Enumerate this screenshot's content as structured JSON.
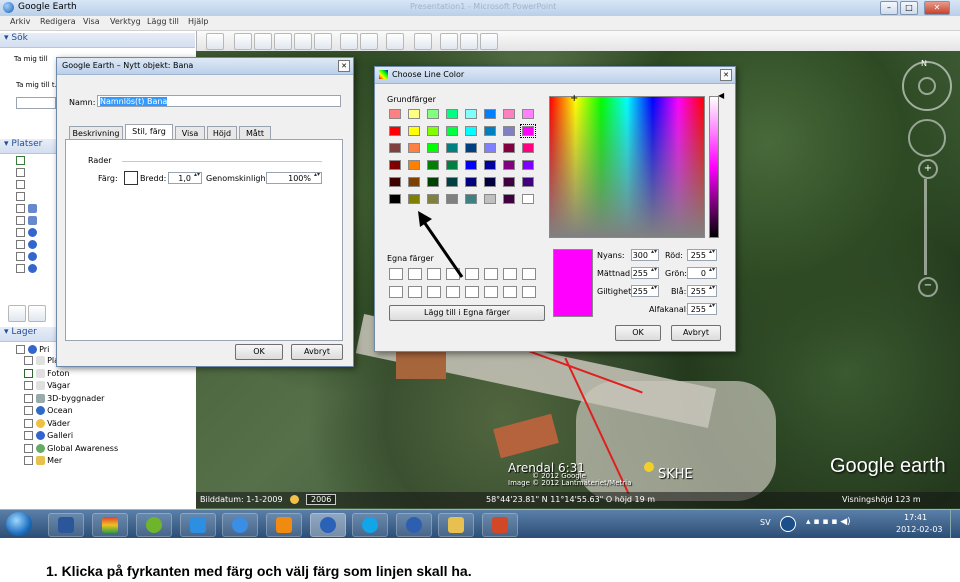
{
  "window": {
    "title": "Google Earth",
    "ghost_title": "Presentation1 - Microsoft PowerPoint",
    "controls": [
      "–",
      "□",
      "✕"
    ]
  },
  "menu": [
    "Arkiv",
    "Redigera",
    "Visa",
    "Verktyg",
    "Lägg till",
    "Hjälp"
  ],
  "sidebar": {
    "search_header": "Sök",
    "search_hint_1": "Ta mig till",
    "search_hint_2": "Ta mig till t.",
    "places_header": "Platser",
    "layers_header": "Lager",
    "layers_root_label": "Pri",
    "layers": [
      "Platser",
      "Foton",
      "Vägar",
      "3D-byggnader",
      "Ocean",
      "Väder",
      "Galleri",
      "Global Awareness",
      "Mer"
    ]
  },
  "new_object_dialog": {
    "title": "Google Earth – Nytt objekt: Bana",
    "name_label": "Namn:",
    "name_value": "Namnlös(t) Bana",
    "tabs": [
      "Beskrivning",
      "Stil, färg",
      "Visa",
      "Höjd",
      "Mått"
    ],
    "active_tab_index": 1,
    "section_title": "Rader",
    "color_label": "Färg:",
    "width_label": "Bredd:",
    "width_value": "1,0",
    "opacity_label": "Genomskinlighet:",
    "opacity_value": "100%",
    "ok_label": "OK",
    "cancel_label": "Avbryt"
  },
  "color_dialog": {
    "title": "Choose Line Color",
    "basic_colors_label": "Grundfärger",
    "custom_colors_label": "Egna färger",
    "add_custom_label": "Lägg till i Egna färger",
    "basic_colors": [
      "#ff8080",
      "#ffff80",
      "#80ff80",
      "#00ff80",
      "#80ffff",
      "#0080ff",
      "#ff80c0",
      "#ff80ff",
      "#ff0000",
      "#ffff00",
      "#80ff00",
      "#00ff40",
      "#00ffff",
      "#0080c0",
      "#8080c0",
      "#ff00ff",
      "#804040",
      "#ff8040",
      "#00ff00",
      "#008080",
      "#004080",
      "#8080ff",
      "#800040",
      "#ff0080",
      "#800000",
      "#ff8000",
      "#008000",
      "#008040",
      "#0000ff",
      "#0000a0",
      "#800080",
      "#8000ff",
      "#400000",
      "#804000",
      "#004000",
      "#004040",
      "#000080",
      "#000040",
      "#400040",
      "#400080",
      "#000000",
      "#808000",
      "#808040",
      "#808080",
      "#408080",
      "#c0c0c0",
      "#400040",
      "#ffffff"
    ],
    "selected_color": "#ff00ff",
    "hue_label": "Nyans:",
    "hue_value": "300",
    "sat_label": "Mättnad:",
    "sat_value": "255",
    "lum_label": "Giltighet:",
    "lum_value": "255",
    "red_label": "Röd:",
    "red_value": "255",
    "green_label": "Grön:",
    "green_value": "0",
    "blue_label": "Blå:",
    "blue_value": "255",
    "alpha_label": "Alfakanal:",
    "alpha_value": "255",
    "ok_label": "OK",
    "cancel_label": "Avbryt"
  },
  "map": {
    "place_label_1": "Arendal 6:31",
    "place_label_2": "SKHE",
    "copyright": "Image © 2012 Lantmäteriet/Metria",
    "copyright_prefix": "© 2012 Google",
    "logo": "Google earth",
    "imagery_date_label": "Bilddatum: 1-1-2009",
    "year_badge": "2006",
    "coords": "58°44'23.81\" N  11°14'55.63\" O  höjd     19 m",
    "eye_alt": "Visningshöjd     123 m",
    "compass_n": "N"
  },
  "taskbar": {
    "lang": "SV",
    "time": "17:41",
    "date": "2012-02-03"
  },
  "caption": "1.  Klicka på fyrkanten med färg och välj färg som linjen skall ha."
}
